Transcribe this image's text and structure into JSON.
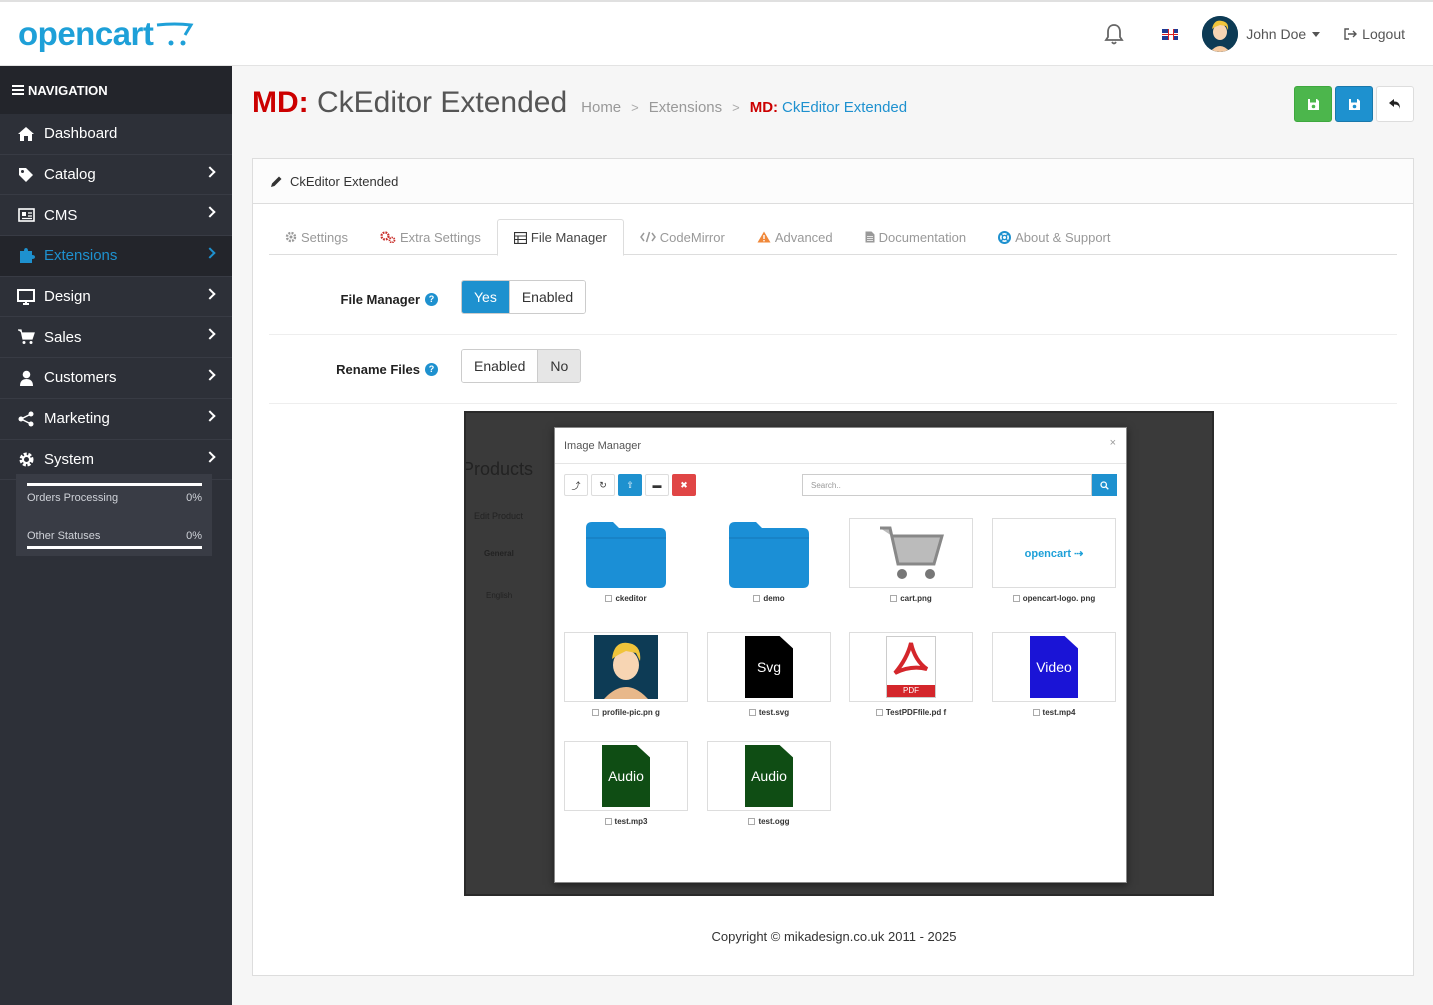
{
  "header": {
    "logo": "opencart",
    "user_name": "John Doe",
    "logout_label": "Logout"
  },
  "sidebar": {
    "nav_title": "NAVIGATION",
    "items": [
      {
        "label": "Dashboard",
        "icon": "home-icon"
      },
      {
        "label": "Catalog",
        "icon": "tag-icon"
      },
      {
        "label": "CMS",
        "icon": "newspaper-icon"
      },
      {
        "label": "Extensions",
        "icon": "puzzle-icon"
      },
      {
        "label": "Design",
        "icon": "monitor-icon"
      },
      {
        "label": "Sales",
        "icon": "cart-icon"
      },
      {
        "label": "Customers",
        "icon": "user-icon"
      },
      {
        "label": "Marketing",
        "icon": "share-icon"
      },
      {
        "label": "System",
        "icon": "gear-icon"
      }
    ],
    "stats": [
      {
        "label": "Orders Processing",
        "value": "0%",
        "progress": 0
      },
      {
        "label": "Other Statuses",
        "value": "0%",
        "progress": 0
      }
    ]
  },
  "page": {
    "title_prefix": "MD:",
    "title": "CkEditor Extended",
    "breadcrumb": [
      "Home",
      "Extensions"
    ],
    "breadcrumb_current_prefix": "MD:",
    "breadcrumb_current": "CkEditor Extended"
  },
  "panel": {
    "heading": "CkEditor Extended",
    "tabs": [
      "Settings",
      "Extra Settings",
      "File Manager",
      "CodeMirror",
      "Advanced",
      "Documentation",
      "About & Support"
    ],
    "active_tab": "File Manager"
  },
  "form": {
    "file_manager": {
      "label": "File Manager",
      "on": "Yes",
      "off": "Enabled"
    },
    "rename_files": {
      "label": "Rename Files",
      "on": "Enabled",
      "off": "No"
    }
  },
  "preview": {
    "bg_title": "Products",
    "bg_edit": "Edit Product",
    "bg_tab": "General",
    "bg_lang": "English",
    "modal_title": "Image Manager",
    "search_placeholder": "Search..",
    "files": [
      {
        "name": "ckeditor",
        "type": "folder"
      },
      {
        "name": "demo",
        "type": "folder"
      },
      {
        "name": "cart.png",
        "type": "image"
      },
      {
        "name": "opencart-logo. png",
        "type": "image"
      },
      {
        "name": "profile-pic.pn g",
        "type": "image"
      },
      {
        "name": "test.svg",
        "type": "svg",
        "badge": "Svg"
      },
      {
        "name": "TestPDFfile.pd f",
        "type": "pdf",
        "badge": "PDF"
      },
      {
        "name": "test.mp4",
        "type": "video",
        "badge": "Video"
      },
      {
        "name": "test.mp3",
        "type": "audio",
        "badge": "Audio"
      },
      {
        "name": "test.ogg",
        "type": "audio",
        "badge": "Audio"
      }
    ]
  },
  "footer": "Copyright © mikadesign.co.uk 2011 - 2025",
  "colors": {
    "accent": "#1e91cf",
    "sidebar_bg": "#2d3038",
    "save_green": "#4cb64c",
    "brand_red": "#cc0000"
  }
}
